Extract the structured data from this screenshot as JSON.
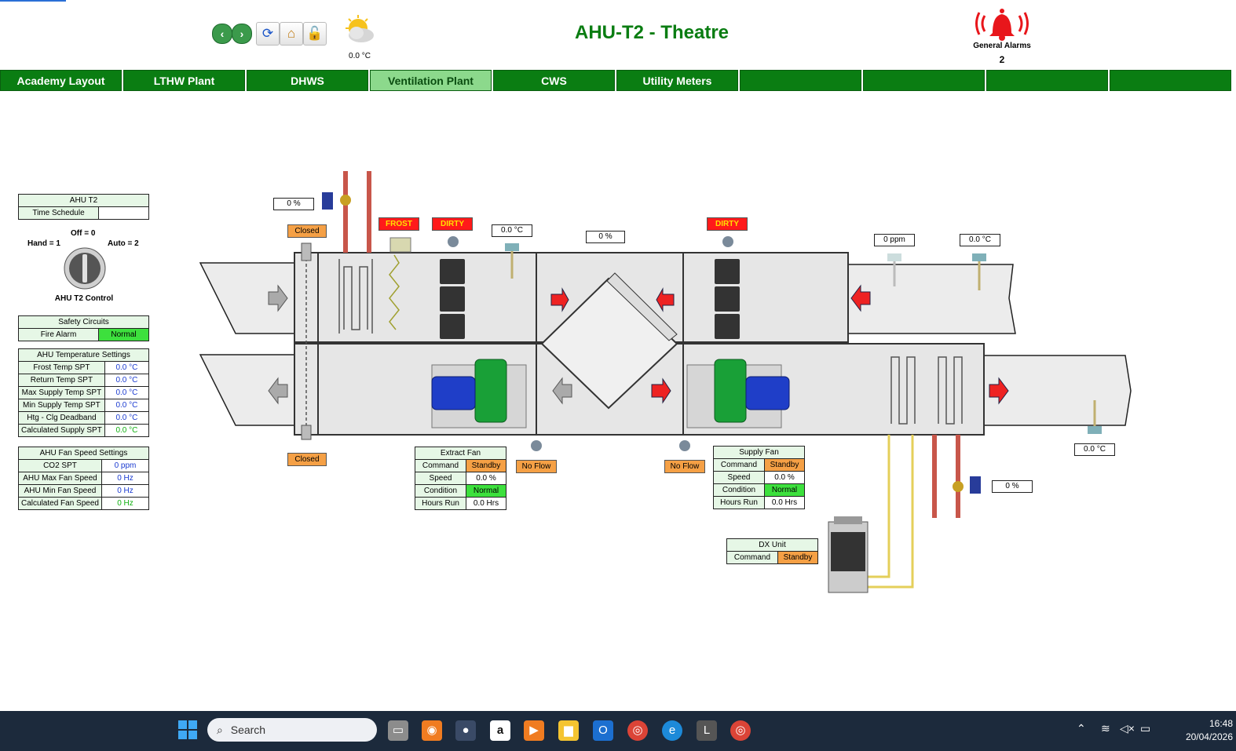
{
  "header": {
    "title": "AHU-T2 - Theatre",
    "outside_temp": "0.0 °C",
    "alarm_label": "General Alarms",
    "alarm_count": "2"
  },
  "menu": [
    {
      "label": "Academy Layout"
    },
    {
      "label": "LTHW Plant"
    },
    {
      "label": "DHWS"
    },
    {
      "label": "Ventilation Plant"
    },
    {
      "label": "CWS"
    },
    {
      "label": "Utility Meters"
    },
    {
      "label": ""
    },
    {
      "label": ""
    },
    {
      "label": ""
    },
    {
      "label": ""
    }
  ],
  "ahu_panel": {
    "title": "AHU T2",
    "time_schedule_label": "Time Schedule",
    "time_schedule_value": ""
  },
  "control": {
    "off": "Off = 0",
    "hand": "Hand = 1",
    "auto": "Auto = 2",
    "label": "AHU T2 Control"
  },
  "safety": {
    "title": "Safety Circuits",
    "fire_label": "Fire Alarm",
    "fire_value": "Normal"
  },
  "temps": {
    "title": "AHU Temperature Settings",
    "rows": [
      {
        "label": "Frost Temp SPT",
        "value": "0.0 °C"
      },
      {
        "label": "Return Temp SPT",
        "value": "0.0 °C"
      },
      {
        "label": "Max Supply Temp SPT",
        "value": "0.0 °C"
      },
      {
        "label": "Min Supply Temp SPT",
        "value": "0.0 °C"
      },
      {
        "label": "Htg - Clg Deadband",
        "value": "0.0 °C"
      },
      {
        "label": "Calculated Supply SPT",
        "value": "0.0 °C"
      }
    ]
  },
  "fanspeed": {
    "title": "AHU Fan Speed Settings",
    "rows": [
      {
        "label": "CO2 SPT",
        "value": "0 ppm"
      },
      {
        "label": "AHU Max Fan Speed",
        "value": "0 Hz"
      },
      {
        "label": "AHU Min Fan Speed",
        "value": "0 Hz"
      },
      {
        "label": "Calculated Fan Speed",
        "value": "0 Hz"
      }
    ]
  },
  "plant": {
    "htg_valve": "0 %",
    "damper_top": "Closed",
    "damper_bottom": "Closed",
    "frost": "FROST",
    "dirty1": "DIRTY",
    "dirty2": "DIRTY",
    "mix_temp": "0.0 °C",
    "recovery_damper": "0 %",
    "return_co2": "0 ppm",
    "return_temp": "0.0 °C",
    "supply_temp": "0.0 °C",
    "clg_valve": "0 %",
    "extract_flow": "No Flow",
    "supply_flow": "No Flow"
  },
  "extract_fan": {
    "title": "Extract Fan",
    "rows": [
      {
        "label": "Command",
        "value": "Standby"
      },
      {
        "label": "Speed",
        "value": "0.0 %"
      },
      {
        "label": "Condition",
        "value": "Normal"
      },
      {
        "label": "Hours Run",
        "value": "0.0 Hrs"
      }
    ]
  },
  "supply_fan": {
    "title": "Supply Fan",
    "rows": [
      {
        "label": "Command",
        "value": "Standby"
      },
      {
        "label": "Speed",
        "value": "0.0 %"
      },
      {
        "label": "Condition",
        "value": "Normal"
      },
      {
        "label": "Hours Run",
        "value": "0.0 Hrs"
      }
    ]
  },
  "dx": {
    "title": "DX Unit",
    "command_label": "Command",
    "command_value": "Standby"
  },
  "taskbar": {
    "search_placeholder": "Search",
    "time": "16:48",
    "date": "20/04/2026"
  },
  "colors": {
    "menu_green": "#0a7d12",
    "active_tab": "#8cd98c",
    "normal": "#3de03d",
    "standby": "#f5a045",
    "alarm_red": "#ff1a1a"
  }
}
